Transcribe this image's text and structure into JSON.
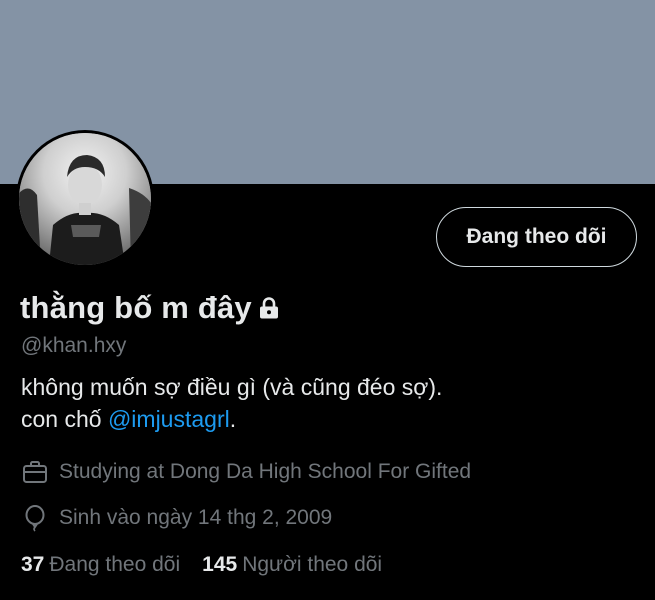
{
  "profile": {
    "display_name": "thằng bố m đây",
    "handle": "@khan.hxy",
    "bio_line1": "không muốn sợ điều gì (và cũng đéo sợ).",
    "bio_line2_prefix": "con chố ",
    "bio_mention": "@imjustagrl",
    "bio_line2_suffix": ".",
    "work": "Studying at Dong Da High School For Gifted",
    "birthday": "Sinh vào ngày 14 thg 2, 2009",
    "protected_icon": "lock-icon",
    "work_icon": "briefcase-icon",
    "birthday_icon": "balloon-icon"
  },
  "follow_button": {
    "label": "Đang theo dõi"
  },
  "stats": {
    "following_count": "37",
    "following_label": "Đang theo dõi",
    "followers_count": "145",
    "followers_label": "Người theo dõi"
  },
  "colors": {
    "banner": "#8493a5",
    "background": "#000000",
    "primary_text": "#e7e9ea",
    "secondary_text": "#71767b",
    "link": "#1d9bf0"
  }
}
